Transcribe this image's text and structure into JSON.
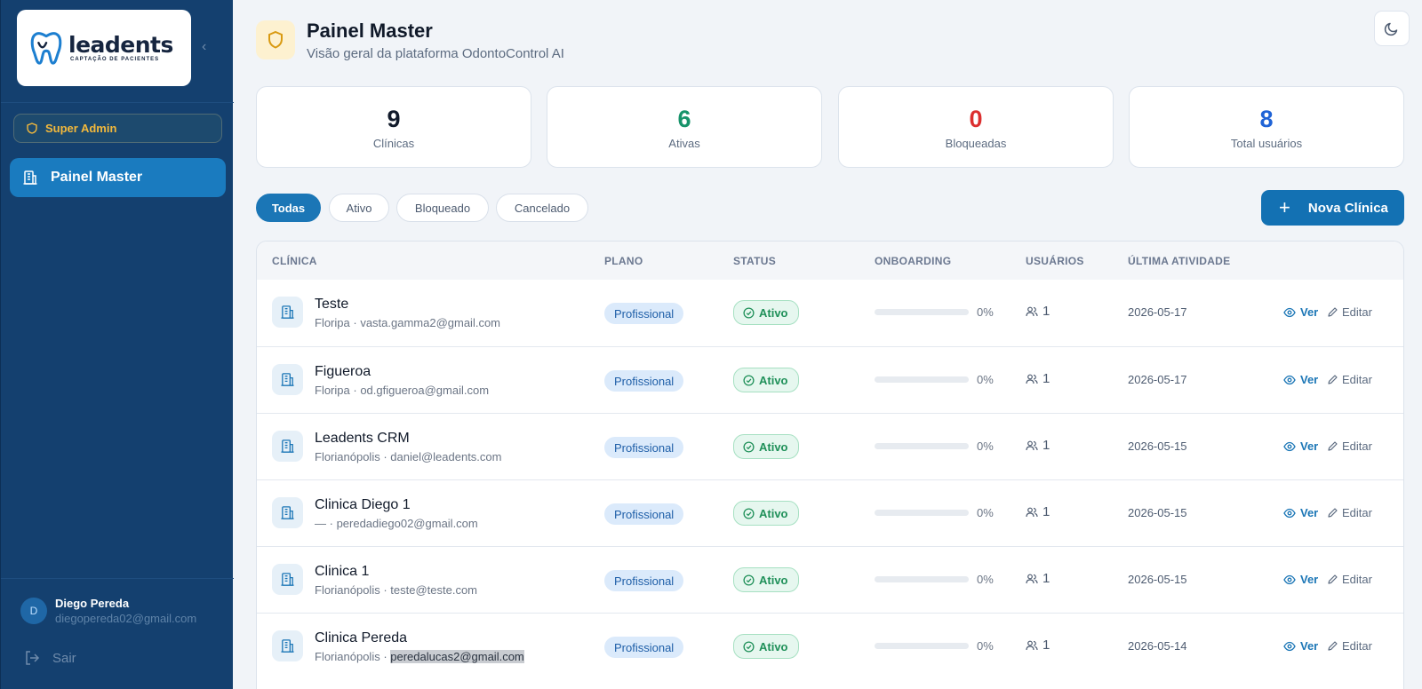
{
  "brand": {
    "name": "leadents",
    "tagline": "CAPTAÇÃO DE PACIENTES"
  },
  "sidebar": {
    "role": "Super Admin",
    "nav": [
      {
        "label": "Painel Master",
        "icon": "building-icon",
        "active": true
      }
    ],
    "user": {
      "initial": "D",
      "name": "Diego Pereda",
      "email": "diegopereda02@gmail.com"
    },
    "logout": "Sair"
  },
  "header": {
    "title": "Painel Master",
    "subtitle": "Visão geral da plataforma OdontoControl AI"
  },
  "stats": [
    {
      "value": "9",
      "label": "Clínicas",
      "color": "#111a2a"
    },
    {
      "value": "6",
      "label": "Ativas",
      "color": "#17936a"
    },
    {
      "value": "0",
      "label": "Bloqueadas",
      "color": "#dc2f2f"
    },
    {
      "value": "8",
      "label": "Total usuários",
      "color": "#1f63d6"
    }
  ],
  "filters": [
    "Todas",
    "Ativo",
    "Bloqueado",
    "Cancelado"
  ],
  "active_filter": "Todas",
  "new_button": "Nova Clínica",
  "table": {
    "columns": [
      "CLÍNICA",
      "PLANO",
      "STATUS",
      "ONBOARDING",
      "USUÁRIOS",
      "ÚLTIMA ATIVIDADE"
    ],
    "actions": {
      "view": "Ver",
      "edit": "Editar"
    },
    "rows": [
      {
        "name": "Teste",
        "city": "Floripa",
        "email": "vasta.gamma2@gmail.com",
        "plan": "Profissional",
        "status": "Ativo",
        "onboarding": 0,
        "onboarding_text": "0%",
        "users": "1",
        "last_activity": "2026-05-17"
      },
      {
        "name": "Figueroa",
        "city": "Floripa",
        "email": "od.gfigueroa@gmail.com",
        "plan": "Profissional",
        "status": "Ativo",
        "onboarding": 0,
        "onboarding_text": "0%",
        "users": "1",
        "last_activity": "2026-05-17"
      },
      {
        "name": "Leadents CRM",
        "city": "Florianópolis",
        "email": "daniel@leadents.com",
        "plan": "Profissional",
        "status": "Ativo",
        "onboarding": 0,
        "onboarding_text": "0%",
        "users": "1",
        "last_activity": "2026-05-15"
      },
      {
        "name": "Clinica Diego 1",
        "city": "—",
        "email": "peredadiego02@gmail.com",
        "plan": "Profissional",
        "status": "Ativo",
        "onboarding": 0,
        "onboarding_text": "0%",
        "users": "1",
        "last_activity": "2026-05-15"
      },
      {
        "name": "Clinica 1",
        "city": "Florianópolis",
        "email": "teste@teste.com",
        "plan": "Profissional",
        "status": "Ativo",
        "onboarding": 0,
        "onboarding_text": "0%",
        "users": "1",
        "last_activity": "2026-05-15"
      },
      {
        "name": "Clinica Pereda",
        "city": "Florianópolis",
        "email": "peredalucas2@gmail.com",
        "email_highlighted": true,
        "plan": "Profissional",
        "status": "Ativo",
        "onboarding": 0,
        "onboarding_text": "0%",
        "users": "1",
        "last_activity": "2026-05-14"
      }
    ]
  }
}
